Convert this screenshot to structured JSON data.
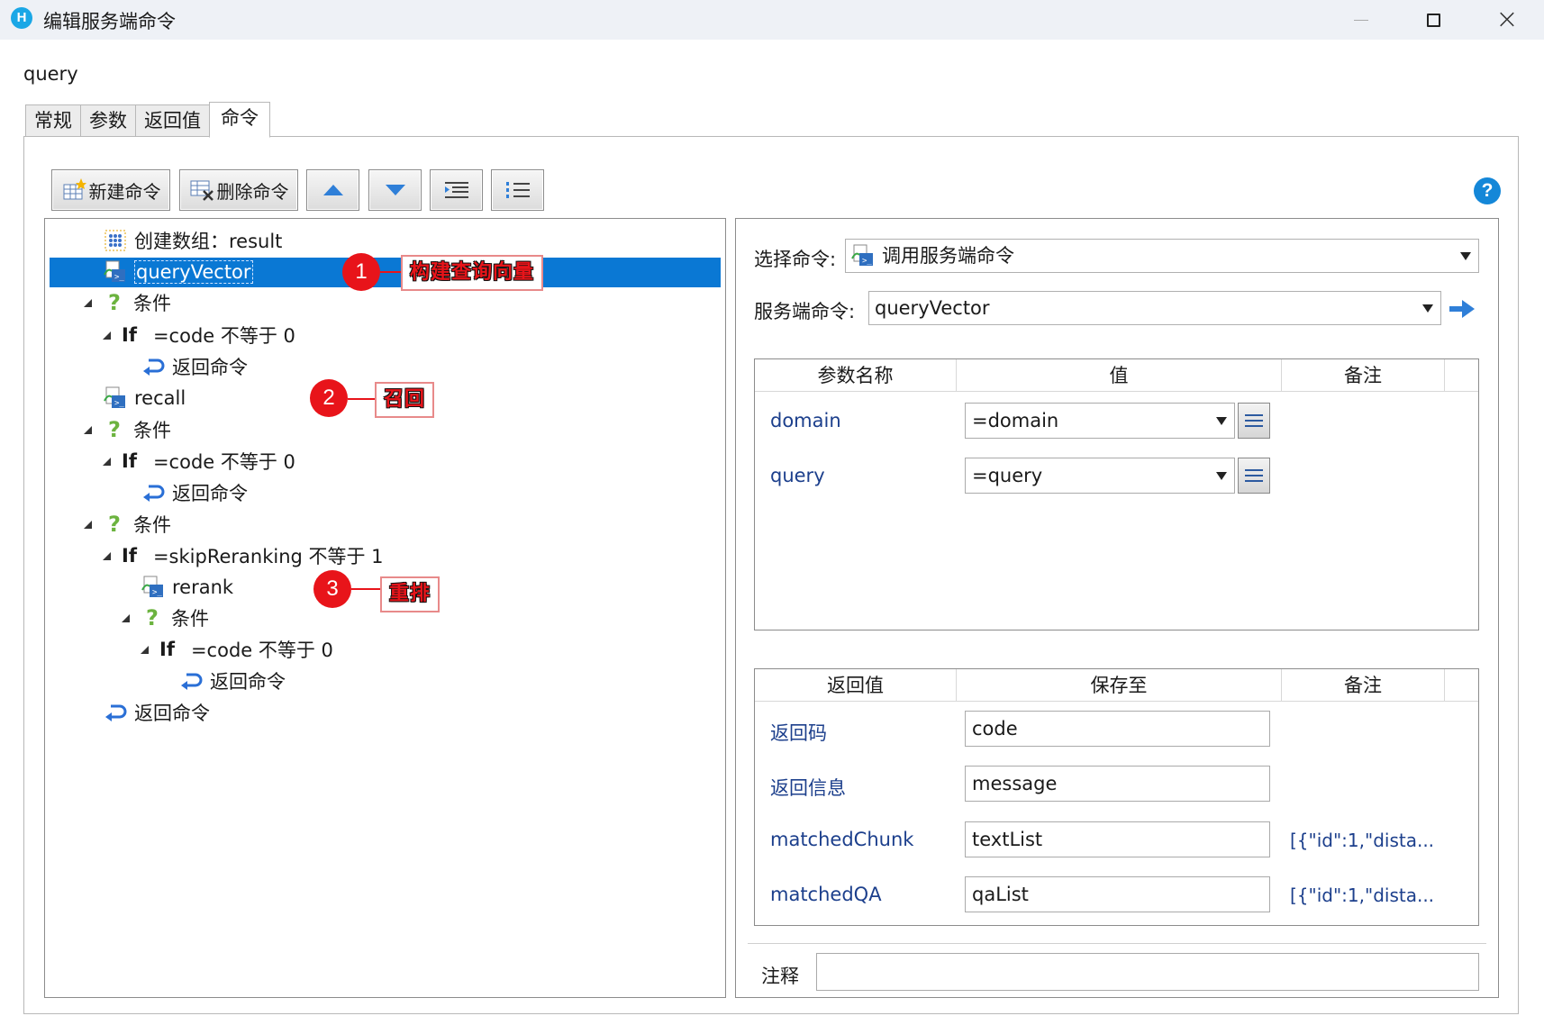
{
  "window": {
    "title": "编辑服务端命令",
    "app_icon_letter": "H"
  },
  "command_name": "query",
  "tabs": [
    {
      "label": "常规"
    },
    {
      "label": "参数"
    },
    {
      "label": "返回值"
    },
    {
      "label": "命令"
    }
  ],
  "toolbar": {
    "new_command": "新建命令",
    "delete_command": "删除命令",
    "icons": [
      "move-up-icon",
      "move-down-icon",
      "indent-icon",
      "outdent-icon"
    ],
    "help": "?"
  },
  "tree": [
    {
      "label": "创建数组：result"
    },
    {
      "label": "queryVector",
      "selected": true
    },
    {
      "label": "条件"
    },
    {
      "keyword": "If",
      "label": "=code 不等于 0"
    },
    {
      "label": "返回命令"
    },
    {
      "label": "recall"
    },
    {
      "label": "条件"
    },
    {
      "keyword": "If",
      "label": "=code 不等于 0"
    },
    {
      "label": "返回命令"
    },
    {
      "label": "条件"
    },
    {
      "keyword": "If",
      "label": "=skipReranking 不等于 1"
    },
    {
      "label": "rerank"
    },
    {
      "label": "条件"
    },
    {
      "keyword": "If",
      "label": "=code 不等于 0"
    },
    {
      "label": "返回命令"
    },
    {
      "label": "返回命令"
    }
  ],
  "callouts": [
    {
      "number": "1",
      "text": "构建查询向量"
    },
    {
      "number": "2",
      "text": "召回"
    },
    {
      "number": "3",
      "text": "重排"
    }
  ],
  "right": {
    "select_command_label": "选择命令:",
    "select_command_value": "调用服务端命令",
    "server_command_label": "服务端命令:",
    "server_command_value": "queryVector",
    "params": {
      "headers": [
        "参数名称",
        "值",
        "备注"
      ],
      "rows": [
        {
          "name": "domain",
          "value": "=domain"
        },
        {
          "name": "query",
          "value": "=query"
        }
      ]
    },
    "returns": {
      "headers": [
        "返回值",
        "保存至",
        "备注"
      ],
      "rows": [
        {
          "name": "返回码",
          "save_to": "code",
          "note": ""
        },
        {
          "name": "返回信息",
          "save_to": "message",
          "note": ""
        },
        {
          "name": "matchedChunk",
          "save_to": "textList",
          "note": "[{\"id\":1,\"dista..."
        },
        {
          "name": "matchedQA",
          "save_to": "qaList",
          "note": "[{\"id\":1,\"dista..."
        }
      ]
    },
    "comment_label": "注释",
    "comment_value": ""
  },
  "colors": {
    "selection": "#0a78d4",
    "callout_red": "#e8141a",
    "link_blue": "#1c3f8c"
  }
}
